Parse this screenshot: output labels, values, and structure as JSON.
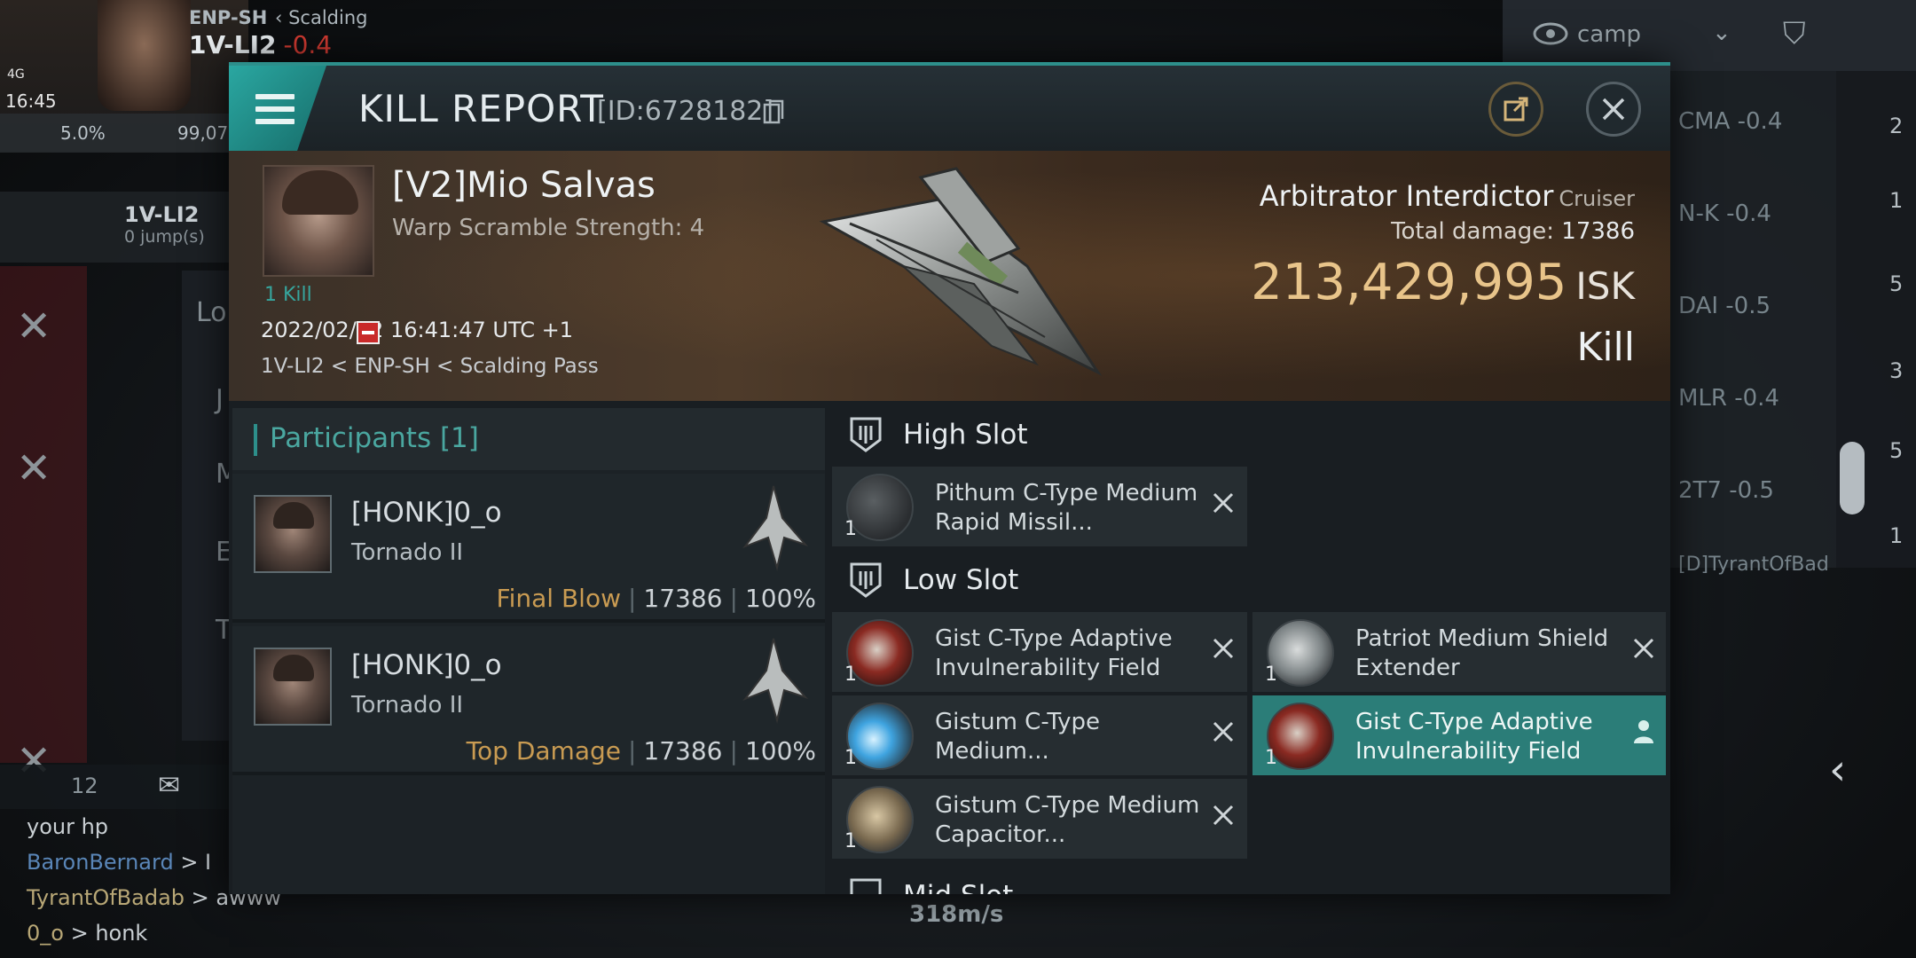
{
  "hud": {
    "status_time": "16:45",
    "network": "4G",
    "dest_system": "ENP-SH",
    "route_system": "Scalding",
    "current_system": "1V-LI2",
    "current_sec": "-0.4",
    "bar_stat1": "5.0%",
    "bar_stat2": "99,07",
    "route_target": "1V-LI2",
    "route_jumps": "0 jump(s)",
    "left_panel_letters": [
      "Lo",
      "J",
      "M",
      "E",
      "T"
    ],
    "chat_count": "12",
    "speed": "318m/s",
    "camp_label": "camp",
    "right_list": [
      "CMA -0.4",
      "N-K -0.4",
      "DAI -0.5",
      "MLR -0.4",
      "2T7 -0.5",
      "[D]TyrantOfBad"
    ],
    "right_counts": [
      "2",
      "1",
      "5",
      "3",
      "5",
      "1"
    ]
  },
  "chat": [
    {
      "name": "",
      "text": "your hp"
    },
    {
      "name": "BaronBernard",
      "text": " > I"
    },
    {
      "name": "TyrantOfBadab",
      "text": " > awww"
    },
    {
      "name": "0_o",
      "text": " > honk"
    }
  ],
  "dialog": {
    "title": "KILL REPORT",
    "id": "[ID:6728182]",
    "victim": {
      "name": "[V2]Mio Salvas",
      "warp_scramble": "Warp Scramble Strength: 4",
      "kills": "1 Kill",
      "datetime": "2022/02/02 16:41:47 UTC +1",
      "location": "1V-LI2 < ENP-SH < Scalding Pass"
    },
    "ship": {
      "name": "Arbitrator Interdictor",
      "class": "Cruiser",
      "damage_label": "Total damage:",
      "damage_value": "17386",
      "isk_value": "213,429,995",
      "isk_unit": "ISK",
      "result": "Kill"
    },
    "participants": {
      "header": "Participants [1]",
      "items": [
        {
          "name": "[HONK]0_o",
          "ship": "Tornado II",
          "role": "Final Blow",
          "damage": "17386",
          "percent": "100%"
        },
        {
          "name": "[HONK]0_o",
          "ship": "Tornado II",
          "role": "Top Damage",
          "damage": "17386",
          "percent": "100%"
        }
      ]
    },
    "fitting": {
      "high_slot_label": "High Slot",
      "low_slot_label": "Low Slot",
      "mid_slot_label": "Mid Slot",
      "high": [
        {
          "name": "Pithum C-Type Medium Rapid Missil...",
          "qty": "1"
        }
      ],
      "low": [
        {
          "name": "Gist C-Type Adaptive Invulnerability Field",
          "qty": "1"
        },
        {
          "name": "Patriot Medium Shield Extender",
          "qty": "1"
        },
        {
          "name": "Gistum C-Type Medium...",
          "qty": "1"
        },
        {
          "name": "Gist C-Type Adaptive Invulnerability Field",
          "qty": "1"
        },
        {
          "name": "Gistum C-Type Medium Capacitor...",
          "qty": "1"
        }
      ]
    }
  },
  "colors": {
    "accent": "#2d8f8b",
    "isk": "#e8c48a",
    "role": "#c99b52",
    "selected": "#2b7d78"
  }
}
